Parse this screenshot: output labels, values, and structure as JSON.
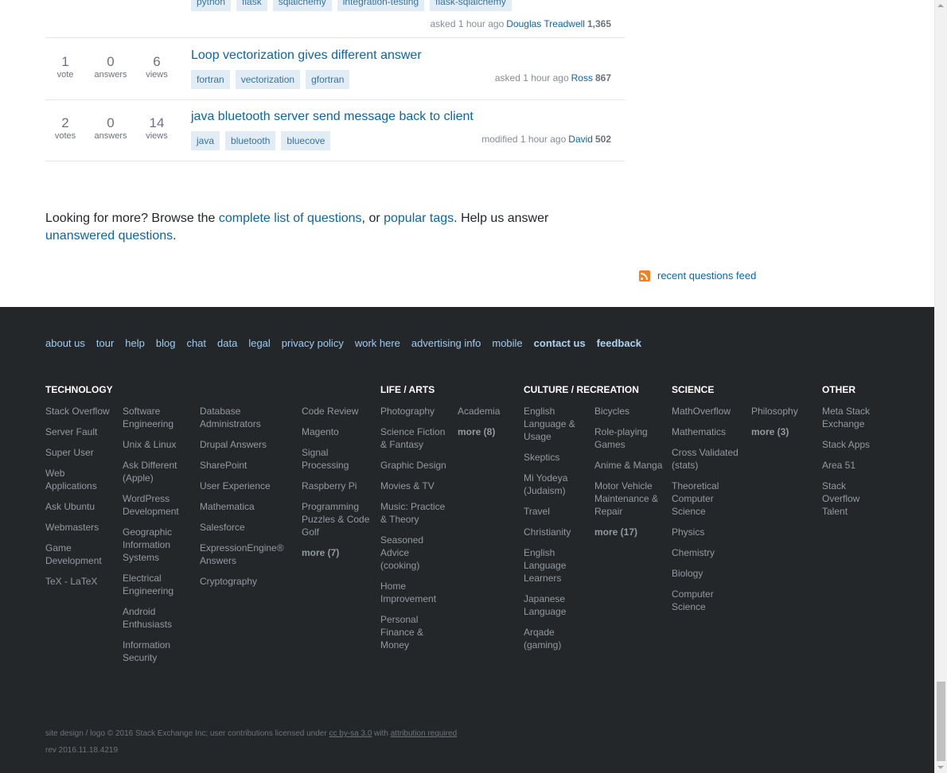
{
  "questions": [
    {
      "tags": [
        "python",
        "flask",
        "sqlalchemy",
        "integration-testing",
        "flask-sqlalchemy"
      ],
      "action": "asked 1 hour ago",
      "user": "Douglas Treadwell",
      "rep": "1,365"
    },
    {
      "votes": "1",
      "votes_label": "vote",
      "answers": "0",
      "answers_label": "answers",
      "views": "6",
      "views_label": "views",
      "title": "Loop vectorization gives different answer",
      "tags": [
        "fortran",
        "vectorization",
        "gfortran"
      ],
      "action": "asked 1 hour ago",
      "user": "Ross",
      "rep": "867"
    },
    {
      "votes": "2",
      "votes_label": "votes",
      "answers": "0",
      "answers_label": "answers",
      "views": "14",
      "views_label": "views",
      "title": "java bluetooth server send message back to client",
      "tags": [
        "java",
        "bluetooth",
        "bluecove"
      ],
      "action": "modified 1 hour ago",
      "user": "David",
      "rep": "502"
    }
  ],
  "more": {
    "prefix": "Looking for more? Browse the ",
    "link1": "complete list of questions",
    "middle": ", or ",
    "link2": "popular tags",
    "suffix": ". Help us answer ",
    "link3": "unanswered questions",
    "end": "."
  },
  "feed": {
    "icon": "rss-icon",
    "label": "recent questions feed",
    "icon_color": "#f48024"
  },
  "footer": {
    "nav": [
      "about us",
      "tour",
      "help",
      "blog",
      "chat",
      "data",
      "legal",
      "privacy policy",
      "work here",
      "advertising info",
      "mobile",
      "contact us",
      "feedback"
    ],
    "categories": {
      "technology": "TECHNOLOGY",
      "life_arts": "LIFE / ARTS",
      "culture": "CULTURE / RECREATION",
      "science": "SCIENCE",
      "other": "OTHER"
    },
    "columns": [
      [
        "Stack Overflow",
        "Server Fault",
        "Super User",
        "Web Applications",
        "Ask Ubuntu",
        "Webmasters",
        "Game Development",
        "TeX - LaTeX"
      ],
      [
        "Software Engineering",
        "Unix & Linux",
        "Ask Different (Apple)",
        "WordPress Development",
        "Geographic Information Systems",
        "Electrical Engineering",
        "Android Enthusiasts",
        "Information Security"
      ],
      [
        "Database Administrators",
        "Drupal Answers",
        "SharePoint",
        "User Experience",
        "Mathematica",
        "Salesforce",
        "ExpressionEngine® Answers",
        "Cryptography"
      ],
      [
        "Code Review",
        "Magento",
        "Signal Processing",
        "Raspberry Pi",
        "Programming Puzzles & Code Golf",
        "more (7)"
      ],
      [
        "Photography",
        "Science Fiction & Fantasy",
        "Graphic Design",
        "Movies & TV",
        "Music: Practice & Theory",
        "Seasoned Advice (cooking)",
        "Home Improvement",
        "Personal Finance & Money"
      ],
      [
        "Academia",
        "more (8)"
      ],
      [
        "English Language & Usage",
        "Skeptics",
        "Mi Yodeya (Judaism)",
        "Travel",
        "Christianity",
        "English Language Learners",
        "Japanese Language",
        "Arqade (gaming)"
      ],
      [
        "Bicycles",
        "Role-playing Games",
        "Anime & Manga",
        "Motor Vehicle Maintenance & Repair",
        "more (17)"
      ],
      [
        "MathOverflow",
        "Mathematics",
        "Cross Validated (stats)",
        "Theoretical Computer Science",
        "Physics",
        "Chemistry",
        "Biology",
        "Computer Science"
      ],
      [
        "Philosophy",
        "more (3)"
      ],
      [
        "Meta Stack Exchange",
        "Stack Apps",
        "Area 51",
        "Stack Overflow Talent"
      ]
    ],
    "copyright": {
      "text": "site design / logo © 2016 Stack Exchange Inc; user contributions licensed under ",
      "license": "cc by-sa 3.0",
      "with": " with ",
      "attribution": "attribution required",
      "rev": "rev 2016.11.18.4219"
    }
  }
}
